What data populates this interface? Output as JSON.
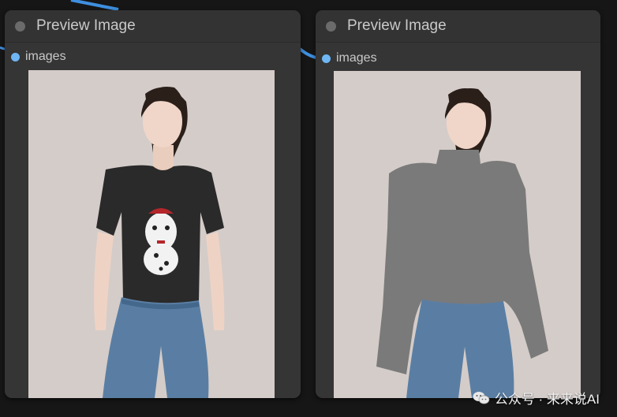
{
  "colors": {
    "canvas_bg": "#161616",
    "node_bg": "#353535",
    "link": "#3f8fe0",
    "slot": "#6fb6f5",
    "mask_fill": "#7a7a7a"
  },
  "nodes": [
    {
      "title": "Preview Image",
      "input_label": "images",
      "image_description": "woman wearing black t-shirt with dalmatian print and blue jeans"
    },
    {
      "title": "Preview Image",
      "input_label": "images",
      "image_description": "same woman with upper garment region masked in gray"
    }
  ],
  "watermark": {
    "text": "公众号 · 来来说AI",
    "icon": "wechat-icon"
  }
}
